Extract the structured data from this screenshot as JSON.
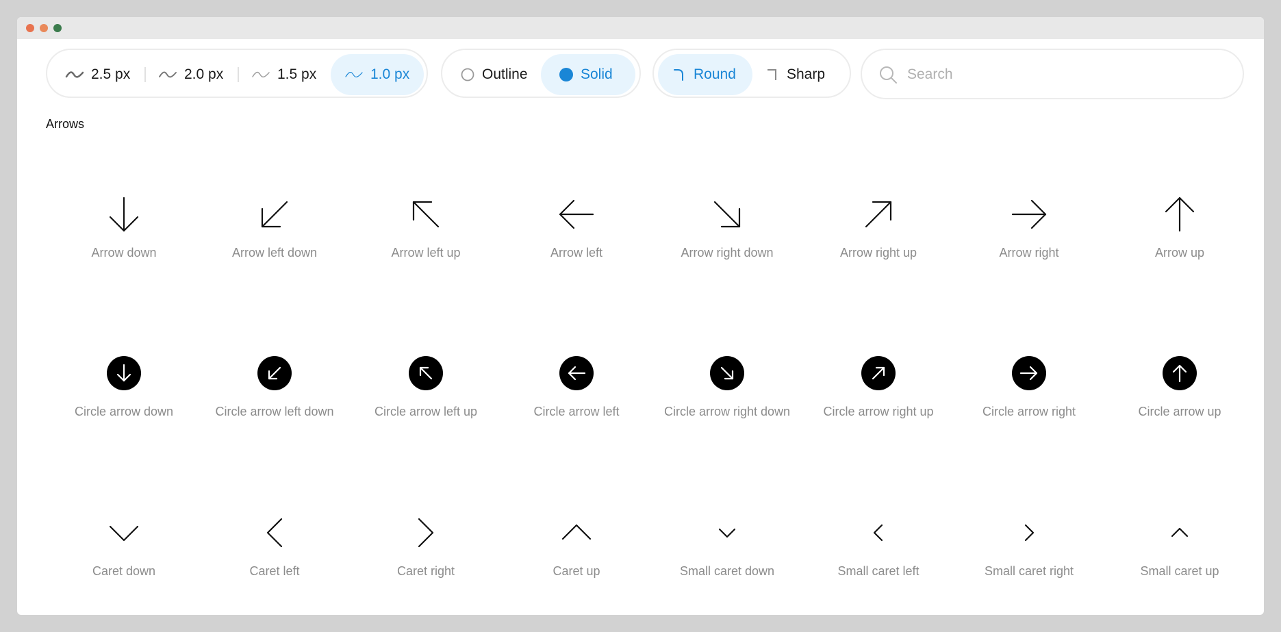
{
  "toolbar": {
    "stroke_widths": [
      {
        "label": "2.5 px",
        "active": false
      },
      {
        "label": "2.0 px",
        "active": false
      },
      {
        "label": "1.5 px",
        "active": false
      },
      {
        "label": "1.0 px",
        "active": true
      }
    ],
    "styles": [
      {
        "label": "Outline",
        "active": false
      },
      {
        "label": "Solid",
        "active": true
      }
    ],
    "corners": [
      {
        "label": "Round",
        "active": true
      },
      {
        "label": "Sharp",
        "active": false
      }
    ],
    "search": {
      "placeholder": "Search",
      "value": ""
    }
  },
  "section": {
    "title": "Arrows"
  },
  "icons": [
    [
      {
        "name": "arrow-down-icon",
        "label": "Arrow down"
      },
      {
        "name": "arrow-left-down-icon",
        "label": "Arrow left down"
      },
      {
        "name": "arrow-left-up-icon",
        "label": "Arrow left up"
      },
      {
        "name": "arrow-left-icon",
        "label": "Arrow left"
      },
      {
        "name": "arrow-right-down-icon",
        "label": "Arrow right down"
      },
      {
        "name": "arrow-right-up-icon",
        "label": "Arrow right up"
      },
      {
        "name": "arrow-right-icon",
        "label": "Arrow right"
      },
      {
        "name": "arrow-up-icon",
        "label": "Arrow up"
      }
    ],
    [
      {
        "name": "circle-arrow-down-icon",
        "label": "Circle arrow down"
      },
      {
        "name": "circle-arrow-left-down-icon",
        "label": "Circle arrow left down"
      },
      {
        "name": "circle-arrow-left-up-icon",
        "label": "Circle arrow left up"
      },
      {
        "name": "circle-arrow-left-icon",
        "label": "Circle arrow left"
      },
      {
        "name": "circle-arrow-right-down-icon",
        "label": "Circle arrow right down"
      },
      {
        "name": "circle-arrow-right-up-icon",
        "label": "Circle arrow right up"
      },
      {
        "name": "circle-arrow-right-icon",
        "label": "Circle arrow right"
      },
      {
        "name": "circle-arrow-up-icon",
        "label": "Circle arrow up"
      }
    ],
    [
      {
        "name": "caret-down-icon",
        "label": "Caret down"
      },
      {
        "name": "caret-left-icon",
        "label": "Caret left"
      },
      {
        "name": "caret-right-icon",
        "label": "Caret right"
      },
      {
        "name": "caret-up-icon",
        "label": "Caret up"
      },
      {
        "name": "small-caret-down-icon",
        "label": "Small caret down"
      },
      {
        "name": "small-caret-left-icon",
        "label": "Small caret left"
      },
      {
        "name": "small-caret-right-icon",
        "label": "Small caret right"
      },
      {
        "name": "small-caret-up-icon",
        "label": "Small caret up"
      }
    ]
  ],
  "colors": {
    "accent": "#1a86d6",
    "accent_bg": "#e7f4fd",
    "label": "#8c8c8c"
  }
}
